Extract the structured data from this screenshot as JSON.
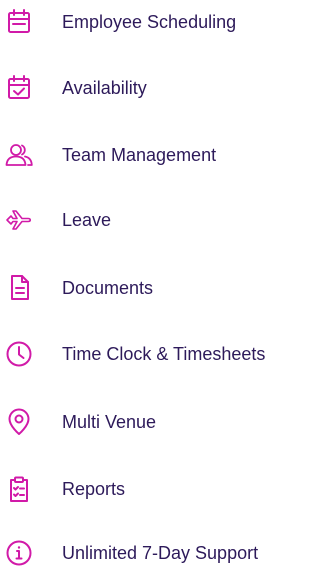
{
  "accent_color": "#d11aa8",
  "text_color": "#2d1a5a",
  "items": [
    {
      "label": "Employee Scheduling",
      "icon": "calendar-icon"
    },
    {
      "label": "Availability",
      "icon": "calendar-check-icon"
    },
    {
      "label": "Team Management",
      "icon": "users-icon"
    },
    {
      "label": "Leave",
      "icon": "plane-icon"
    },
    {
      "label": "Documents",
      "icon": "document-icon"
    },
    {
      "label": "Time Clock & Timesheets",
      "icon": "clock-icon"
    },
    {
      "label": "Multi Venue",
      "icon": "location-pin-icon"
    },
    {
      "label": "Reports",
      "icon": "clipboard-list-icon"
    },
    {
      "label": "Unlimited 7-Day Support",
      "icon": "info-icon"
    }
  ]
}
